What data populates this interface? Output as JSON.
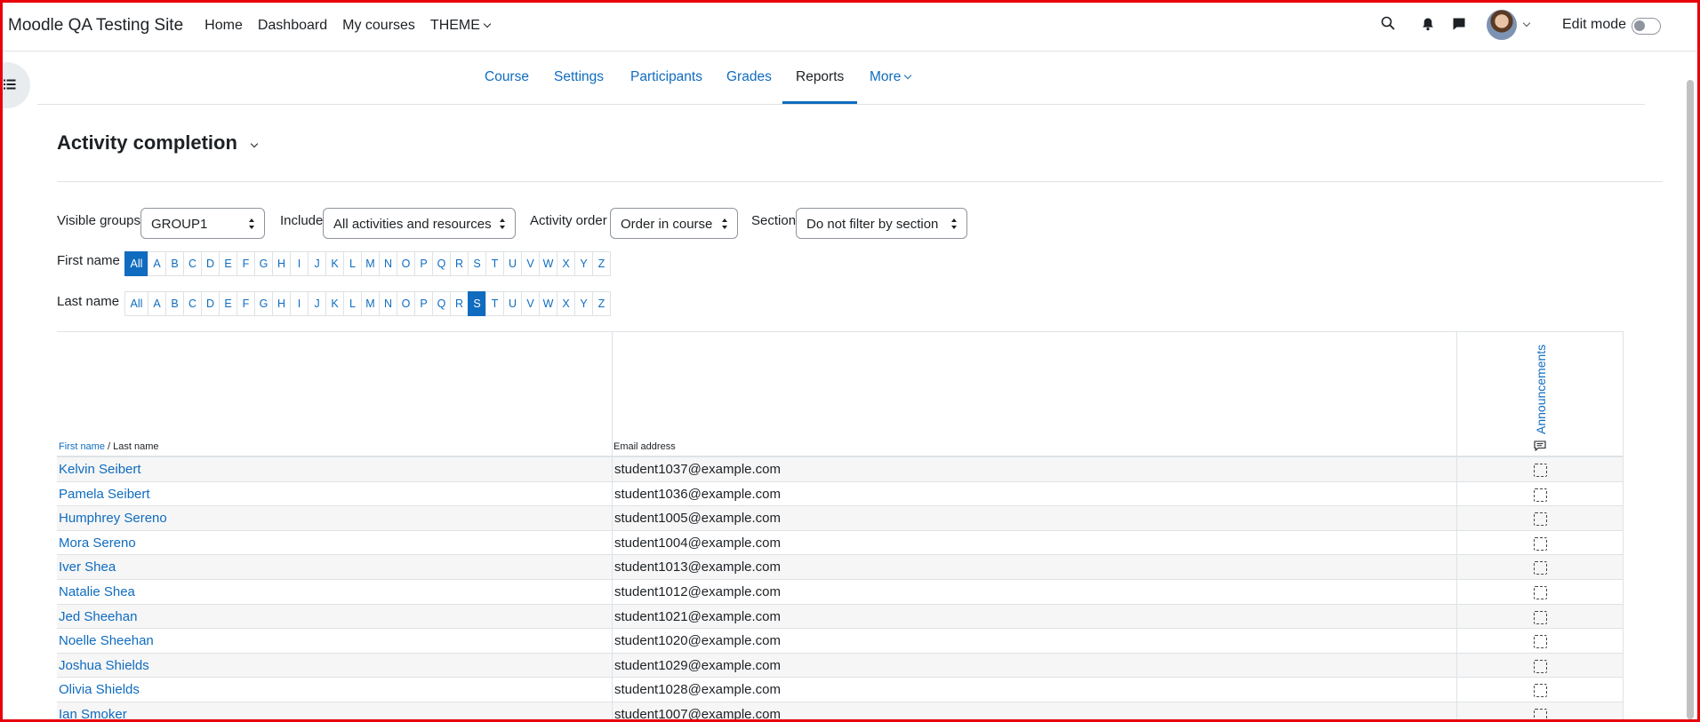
{
  "navbar": {
    "brand": "Moodle QA Testing Site",
    "items": [
      "Home",
      "Dashboard",
      "My courses",
      "THEME"
    ],
    "edit_mode_label": "Edit mode"
  },
  "secondary_nav": {
    "items": [
      "Course",
      "Settings",
      "Participants",
      "Grades",
      "Reports",
      "More"
    ],
    "active": "Reports"
  },
  "page": {
    "title": "Activity completion"
  },
  "filters": {
    "groups_label": "Visible groups",
    "groups_value": "GROUP1",
    "include_label": "Include",
    "include_value": "All activities and resources",
    "order_label": "Activity order",
    "order_value": "Order in course",
    "section_label": "Section",
    "section_value": "Do not filter by section"
  },
  "initials": {
    "first_label": "First name",
    "last_label": "Last name",
    "letters": [
      "All",
      "A",
      "B",
      "C",
      "D",
      "E",
      "F",
      "G",
      "H",
      "I",
      "J",
      "K",
      "L",
      "M",
      "N",
      "O",
      "P",
      "Q",
      "R",
      "S",
      "T",
      "U",
      "V",
      "W",
      "X",
      "Y",
      "Z"
    ],
    "first_selected": "All",
    "last_selected": "S"
  },
  "table": {
    "header_first": "First name",
    "header_sep": " / ",
    "header_last": "Last name",
    "header_email": "Email address",
    "activity": "Announcements",
    "rows": [
      {
        "name": "Kelvin Seibert",
        "email": "student1037@example.com"
      },
      {
        "name": "Pamela Seibert",
        "email": "student1036@example.com"
      },
      {
        "name": "Humphrey Sereno",
        "email": "student1005@example.com"
      },
      {
        "name": "Mora Sereno",
        "email": "student1004@example.com"
      },
      {
        "name": "Iver Shea",
        "email": "student1013@example.com"
      },
      {
        "name": "Natalie Shea",
        "email": "student1012@example.com"
      },
      {
        "name": "Jed Sheehan",
        "email": "student1021@example.com"
      },
      {
        "name": "Noelle Sheehan",
        "email": "student1020@example.com"
      },
      {
        "name": "Joshua Shields",
        "email": "student1029@example.com"
      },
      {
        "name": "Olivia Shields",
        "email": "student1028@example.com"
      },
      {
        "name": "Ian Smoker",
        "email": "student1007@example.com"
      }
    ]
  },
  "colors": {
    "link": "#0f6cbf",
    "frame": "#e8000b"
  }
}
